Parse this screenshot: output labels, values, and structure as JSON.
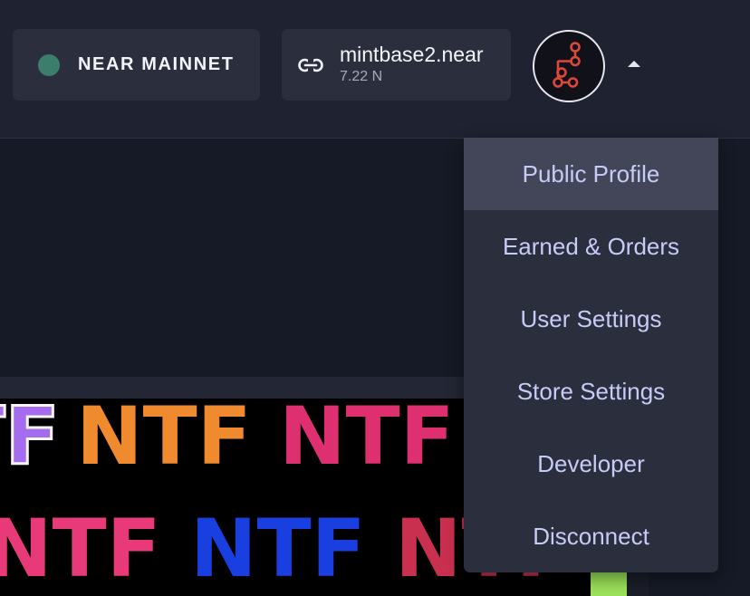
{
  "network": {
    "label": "NEAR MAINNET",
    "status_color": "#3c7e6c"
  },
  "account": {
    "name": "mintbase2.near",
    "balance": "7.22 N",
    "icon": "link-icon"
  },
  "avatar": {
    "icon": "mintbase-logo-icon"
  },
  "menu": {
    "items": [
      {
        "label": "Public Profile",
        "active": true
      },
      {
        "label": "Earned & Orders"
      },
      {
        "label": "User Settings"
      },
      {
        "label": "Store Settings"
      },
      {
        "label": "Developer"
      },
      {
        "label": "Disconnect"
      }
    ]
  },
  "artwork": {
    "text": "NTF",
    "colors": [
      "#a56cf0",
      "#f08a2e",
      "#de3070",
      "#e83a79",
      "#1a3fe0",
      "#c9304f",
      "#9be15a"
    ]
  }
}
